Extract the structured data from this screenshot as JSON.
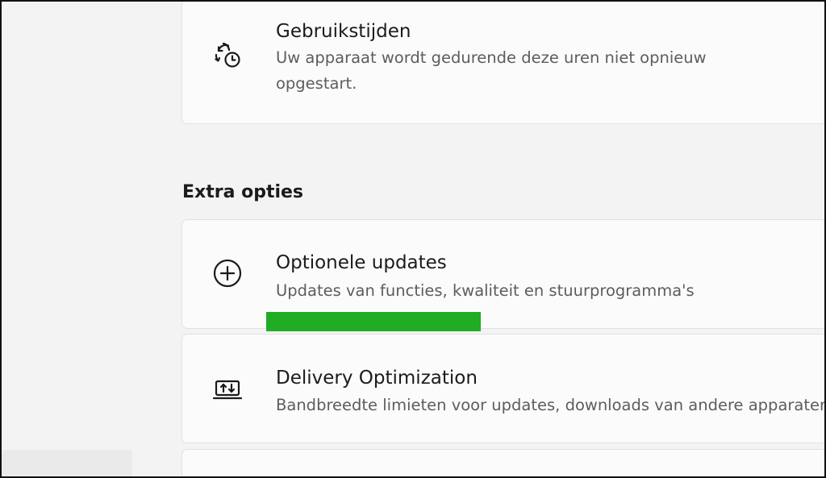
{
  "cards": {
    "usage": {
      "title": "Gebruikstijden",
      "description": "Uw apparaat wordt gedurende deze uren niet opnieuw opgestart.",
      "icon": "clock-sync-icon"
    },
    "optional_updates": {
      "title": "Optionele updates",
      "description": "Updates van functies, kwaliteit en stuurprogramma's",
      "icon": "add-circle-icon"
    },
    "delivery_optimization": {
      "title": "Delivery Optimization",
      "description": "Bandbreedte limieten voor updates, downloads van andere apparaten",
      "icon": "laptop-transfer-icon"
    }
  },
  "sections": {
    "extra_options": "Extra opties"
  },
  "colors": {
    "highlight": "#20ad25",
    "card_background": "#fbfbfb",
    "page_background": "#f3f3f3"
  }
}
